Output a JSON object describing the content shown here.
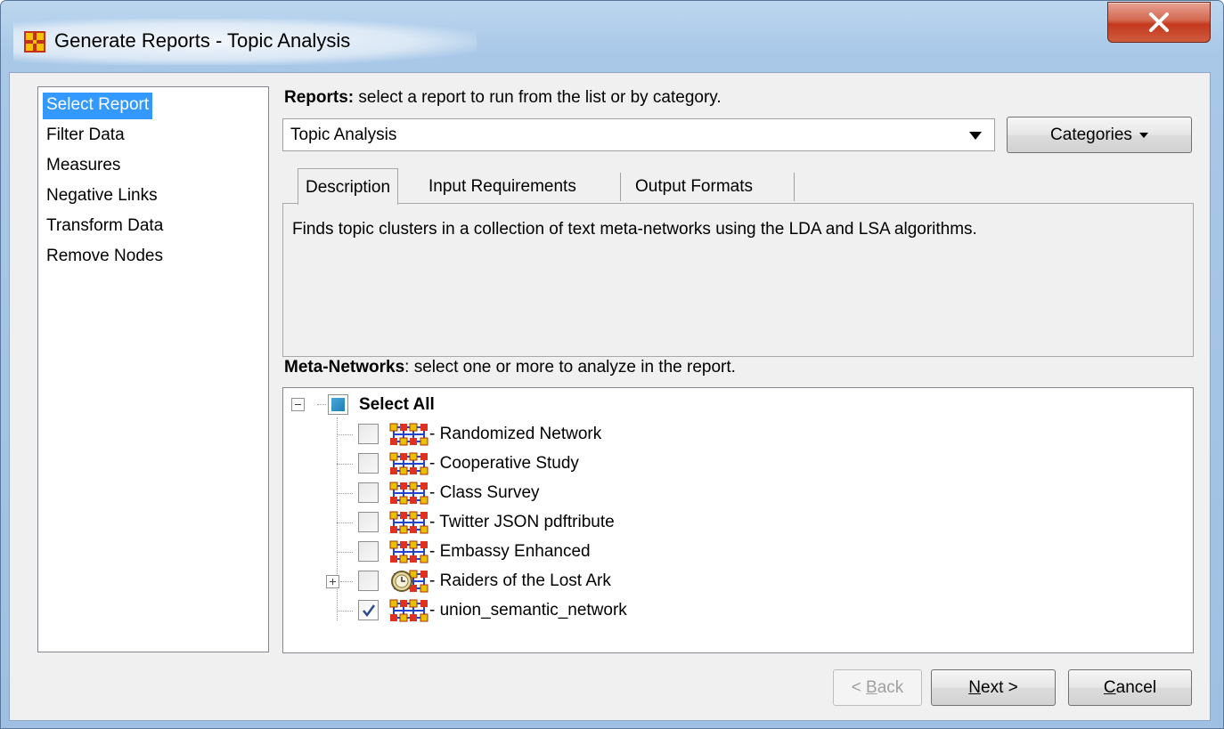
{
  "window": {
    "title": "Generate Reports - Topic Analysis",
    "close_glyph": "X"
  },
  "nav": {
    "items": [
      {
        "label": "Select Report",
        "selected": true
      },
      {
        "label": "Filter Data",
        "selected": false
      },
      {
        "label": "Measures",
        "selected": false
      },
      {
        "label": "Negative Links",
        "selected": false
      },
      {
        "label": "Transform Data",
        "selected": false
      },
      {
        "label": "Remove Nodes",
        "selected": false
      }
    ]
  },
  "reports": {
    "heading_bold": "Reports:",
    "heading_rest": " select a report to run from the list or by category.",
    "selected_value": "Topic Analysis",
    "categories_label": "Categories"
  },
  "tabs": {
    "items": [
      {
        "label": "Description",
        "active": true
      },
      {
        "label": "Input Requirements",
        "active": false
      },
      {
        "label": "Output Formats",
        "active": false
      }
    ],
    "description_text": "Finds topic clusters in a collection of text meta-networks using the LDA and LSA algorithms."
  },
  "meta_networks": {
    "heading_bold": "Meta-Networks",
    "heading_rest": ": select one or more to analyze in the report.",
    "root_label": "Select All",
    "items": [
      {
        "label": "Randomized Network",
        "checked": false,
        "icon": "meta-network-icon",
        "expandable": false
      },
      {
        "label": "Cooperative Study",
        "checked": false,
        "icon": "meta-network-icon",
        "expandable": false
      },
      {
        "label": "Class Survey",
        "checked": false,
        "icon": "meta-network-icon",
        "expandable": false
      },
      {
        "label": "Twitter JSON pdftribute",
        "checked": false,
        "icon": "meta-network-icon",
        "expandable": false
      },
      {
        "label": "Embassy Enhanced",
        "checked": false,
        "icon": "meta-network-icon",
        "expandable": false
      },
      {
        "label": "Raiders of the Lost Ark",
        "checked": false,
        "icon": "dynamic-meta-network-icon",
        "expandable": true
      },
      {
        "label": "union_semantic_network",
        "checked": true,
        "icon": "meta-network-icon",
        "expandable": false
      }
    ],
    "item_prefix": "- "
  },
  "buttons": {
    "back_mnemonic": "B",
    "back_rest": "ack",
    "back_prefix": "< ",
    "next_mnemonic": "N",
    "next_rest": "ext >",
    "cancel_mnemonic": "C",
    "cancel_rest": "ancel"
  },
  "colors": {
    "selection": "#3399ff",
    "window_frame": "#a9c8e8",
    "close_button": "#c4381d"
  }
}
